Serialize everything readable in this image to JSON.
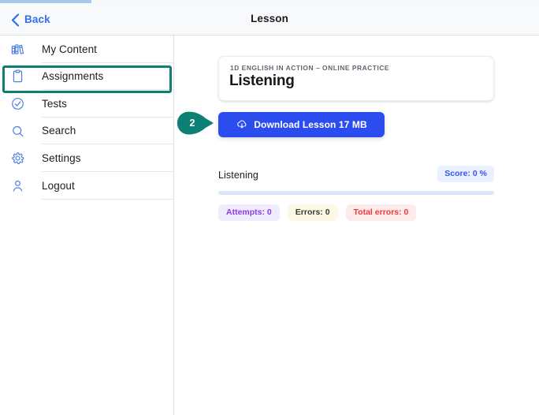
{
  "top_progress": {
    "name": "page-loading-bar",
    "percent": 17,
    "fill_color": "#a8c7ec"
  },
  "header": {
    "back_label": "Back",
    "back_icon": "chevron-left-icon",
    "title": "Lesson",
    "accent_color": "#2f6fed"
  },
  "sidebar": {
    "items": [
      {
        "id": "my-content",
        "label": "My Content",
        "icon": "books-icon",
        "selected": false
      },
      {
        "id": "assignments",
        "label": "Assignments",
        "icon": "clipboard-icon",
        "selected": true
      },
      {
        "id": "tests",
        "label": "Tests",
        "icon": "check-circle-icon",
        "selected": false
      },
      {
        "id": "search",
        "label": "Search",
        "icon": "search-icon",
        "selected": false
      },
      {
        "id": "settings",
        "label": "Settings",
        "icon": "gear-icon",
        "selected": false
      },
      {
        "id": "logout",
        "label": "Logout",
        "icon": "user-icon",
        "selected": false
      }
    ],
    "icon_color": "#4a7fe0",
    "highlight_color": "#0d8074"
  },
  "annotation": {
    "marker_number": "2",
    "marker_color": "#0d8074",
    "shape": "teardrop-pointer-right"
  },
  "lesson_card": {
    "eyebrow": "1D ENGLISH IN ACTION – ONLINE PRACTICE",
    "title": "Listening"
  },
  "download": {
    "label": "Download Lesson 17 MB",
    "icon": "cloud-download-icon",
    "button_color": "#2b4df0"
  },
  "progress": {
    "title": "Listening",
    "score_badge": "Score: 0 %",
    "bar_percent": 0,
    "stats": [
      {
        "id": "attempts",
        "label": "Attempts: 0",
        "bg": "#f1ecfd",
        "fg": "#8b3ce8"
      },
      {
        "id": "errors",
        "label": "Errors: 0",
        "bg": "#fcf8e3",
        "fg": "#3a3a3a"
      },
      {
        "id": "total-errors",
        "label": "Total errors: 0",
        "bg": "#fdeaea",
        "fg": "#f0393c"
      }
    ]
  }
}
